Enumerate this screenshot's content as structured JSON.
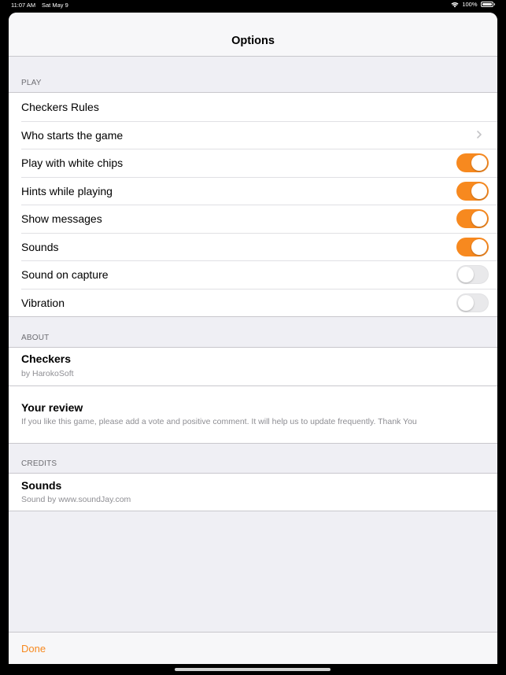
{
  "status_bar": {
    "time": "11:07 AM",
    "date": "Sat May 9",
    "battery": "100%"
  },
  "nav": {
    "title": "Options"
  },
  "sections": {
    "play": {
      "header": "PLAY",
      "rows": [
        {
          "label": "Checkers Rules",
          "accessory": "none"
        },
        {
          "label": "Who starts the game",
          "accessory": "chevron"
        },
        {
          "label": "Play with white chips",
          "accessory": "toggle",
          "on": true
        },
        {
          "label": "Hints while playing",
          "accessory": "toggle",
          "on": true
        },
        {
          "label": "Show messages",
          "accessory": "toggle",
          "on": true
        },
        {
          "label": "Sounds",
          "accessory": "toggle",
          "on": true
        },
        {
          "label": "Sound on capture",
          "accessory": "toggle",
          "on": false
        },
        {
          "label": "Vibration",
          "accessory": "toggle",
          "on": false
        }
      ]
    },
    "about": {
      "header": "ABOUT",
      "items": [
        {
          "title": "Checkers",
          "subtitle": "by HarokoSoft"
        },
        {
          "title": "Your review",
          "subtitle": "If you like this game, please add a vote and positive comment. It will help us to update frequently. Thank You"
        }
      ]
    },
    "credits": {
      "header": "CREDITS",
      "items": [
        {
          "title": "Sounds",
          "subtitle": "Sound by www.soundJay.com"
        }
      ]
    }
  },
  "toolbar": {
    "done_label": "Done"
  },
  "colors": {
    "accent": "#f7891f",
    "background": "#efeff4",
    "toggle_off": "#e9e9eb"
  }
}
